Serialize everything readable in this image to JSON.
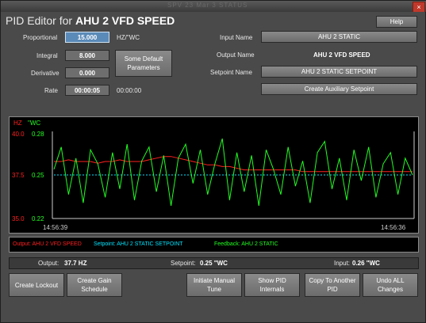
{
  "window": {
    "title_ghost": "SPV 23 Mar 3 STATUS",
    "close_glyph": "×"
  },
  "header": {
    "prefix": "PID Editor for",
    "name": "AHU 2 VFD SPEED",
    "help": "Help"
  },
  "params": {
    "proportional_label": "Proportional",
    "proportional_value": "15.000",
    "proportional_unit": "HZ/\"WC",
    "integral_label": "Integral",
    "integral_value": "8.000",
    "derivative_label": "Derivative",
    "derivative_value": "0.000",
    "rate_label": "Rate",
    "rate_value": "00:00:05",
    "rate_extra": "00:00:00",
    "defaults_button": "Some Default Parameters"
  },
  "io": {
    "input_label": "Input Name",
    "input_value": "AHU 2 STATIC",
    "output_label": "Output Name",
    "output_value": "AHU 2 VFD SPEED",
    "setpoint_label": "Setpoint Name",
    "setpoint_value": "AHU 2 STATIC SETPOINT",
    "aux_button": "Create Auxiliary Setpoint"
  },
  "chart": {
    "left_unit": "HZ",
    "right_unit": "\"WC",
    "ticks_left": [
      "40.0",
      "37.5",
      "35.0"
    ],
    "ticks_right": [
      "0.28",
      "0.25",
      "0.22"
    ],
    "time_start": "14:56:39",
    "time_end": "14:56:36"
  },
  "colors": {
    "output": "#ff2020",
    "setpoint": "#00e5ff",
    "feedback": "#22ff22"
  },
  "chart_data": {
    "type": "line",
    "x": [
      "14:56:39",
      "14:56:36"
    ],
    "xlabel": "",
    "left_axis": {
      "label": "HZ",
      "ylim": [
        35.0,
        40.0
      ],
      "ticks": [
        35.0,
        37.5,
        40.0
      ]
    },
    "right_axis": {
      "label": "\"WC",
      "ylim": [
        0.22,
        0.28
      ],
      "ticks": [
        0.22,
        0.25,
        0.28
      ]
    },
    "grid": false,
    "legend_position": "bottom",
    "series": [
      {
        "name": "Output: AHU 2 VFD SPEED",
        "axis": "left",
        "color": "#ff2020",
        "values": [
          38.3,
          38.3,
          38.4,
          38.3,
          38.3,
          38.3,
          38.2,
          38.3,
          38.3,
          38.4,
          38.3,
          38.3,
          38.3,
          38.4,
          38.5,
          38.6,
          38.6,
          38.5,
          38.4,
          38.3,
          38.2,
          38.1,
          38.1,
          38.0,
          38.0,
          37.9,
          37.8,
          37.8,
          37.8,
          37.8,
          37.8,
          37.8,
          37.8,
          37.8,
          37.7,
          37.7,
          37.7,
          37.7,
          37.7,
          37.7,
          37.7,
          37.7,
          37.7,
          37.7,
          37.7,
          37.7,
          37.7,
          37.7,
          37.7,
          37.7
        ]
      },
      {
        "name": "Setpoint: AHU 2 STATIC SETPOINT",
        "axis": "right",
        "color": "#00e5ff",
        "values": [
          0.25,
          0.25,
          0.25,
          0.25,
          0.25,
          0.25,
          0.25,
          0.25,
          0.25,
          0.25,
          0.25,
          0.25,
          0.25,
          0.25,
          0.25,
          0.25,
          0.25,
          0.25,
          0.25,
          0.25,
          0.25,
          0.25,
          0.25,
          0.25,
          0.25,
          0.25,
          0.25,
          0.25,
          0.25,
          0.25,
          0.25,
          0.25,
          0.25,
          0.25,
          0.25,
          0.25,
          0.25,
          0.25,
          0.25,
          0.25,
          0.25,
          0.25,
          0.25,
          0.25,
          0.25,
          0.25,
          0.25,
          0.25,
          0.25,
          0.25
        ]
      },
      {
        "name": "Feedback: AHU 2 STATIC",
        "axis": "right",
        "color": "#22ff22",
        "values": [
          0.254,
          0.27,
          0.236,
          0.262,
          0.23,
          0.268,
          0.258,
          0.234,
          0.266,
          0.24,
          0.272,
          0.232,
          0.26,
          0.27,
          0.238,
          0.264,
          0.228,
          0.262,
          0.272,
          0.244,
          0.268,
          0.236,
          0.258,
          0.276,
          0.232,
          0.266,
          0.238,
          0.264,
          0.228,
          0.268,
          0.254,
          0.236,
          0.27,
          0.242,
          0.26,
          0.23,
          0.266,
          0.274,
          0.24,
          0.262,
          0.232,
          0.268,
          0.246,
          0.27,
          0.234,
          0.258,
          0.266,
          0.236,
          0.262,
          0.25
        ]
      }
    ]
  },
  "legend": {
    "output": "Output: AHU 2 VFD SPEED",
    "setpoint": "Setpoint: AHU 2 STATIC SETPOINT",
    "feedback": "Feedback: AHU 2 STATIC"
  },
  "status": {
    "output_label": "Output:",
    "output_value": "37.7 HZ",
    "setpoint_label": "Setpoint:",
    "setpoint_value": "0.25 \"WC",
    "input_label": "Input:",
    "input_value": "0.26 \"WC"
  },
  "actions": {
    "create_lockout": "Create Lockout",
    "create_gain": "Create Gain Schedule",
    "manual_tune": "Initiate Manual Tune",
    "show_internals": "Show PID Internals",
    "copy_pid": "Copy To Another PID",
    "undo_all": "Undo ALL Changes"
  }
}
